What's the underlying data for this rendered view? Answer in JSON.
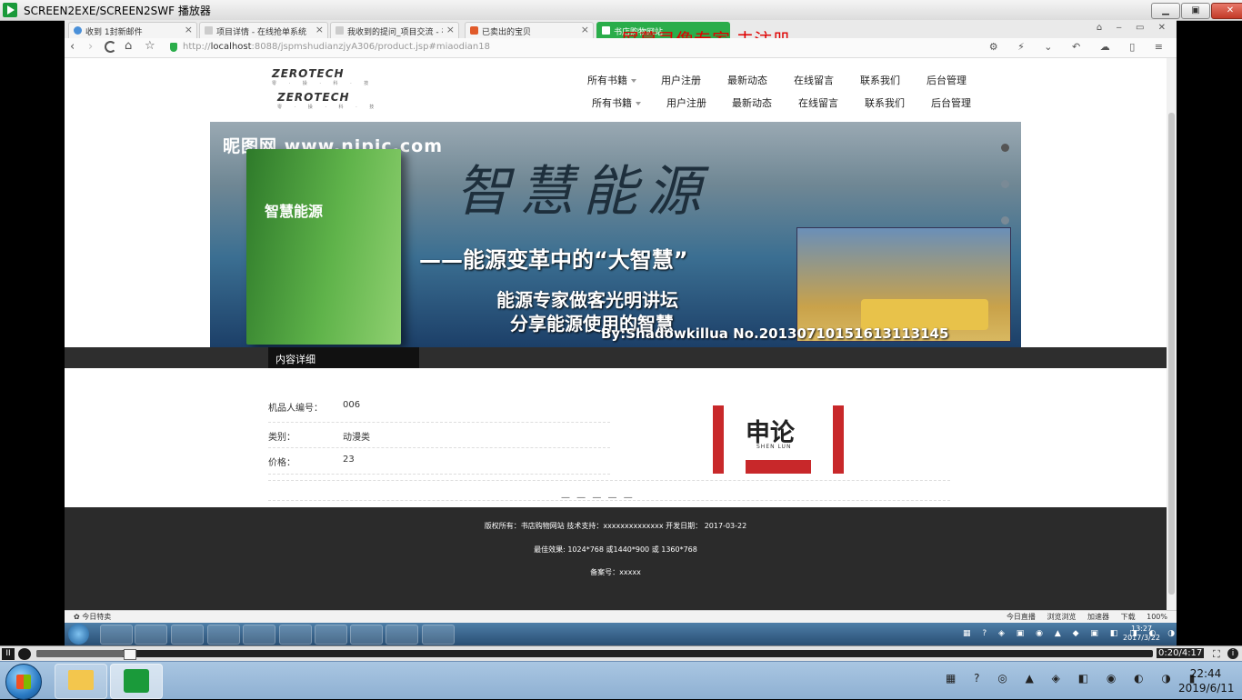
{
  "player": {
    "title": "SCREEN2EXE/SCREEN2SWF 播放器",
    "minimize": "▁",
    "maximize": "▣",
    "close": "✕"
  },
  "browser": {
    "tabs": [
      {
        "label": "收到 1封新邮件"
      },
      {
        "label": "项目详情 - 在线抢单系统"
      },
      {
        "label": "我收到的提问_项目交流 - 在线抢"
      },
      {
        "label": "已卖出的宝贝"
      },
      {
        "label": "书店购物网站"
      }
    ],
    "tab_close": "×",
    "watermark": "屏幕录像专家  未注册",
    "url_prefix": "http://",
    "url_host": "localhost",
    "url_rest": ":8088/jspmshudianzjyA306/product.jsp#miaodian18"
  },
  "site": {
    "logo": "ZEROTECH",
    "logo_sub": "零 · 操 · 科 · 技",
    "menu": [
      "所有书籍",
      "用户注册",
      "最新动态",
      "在线留言",
      "联系我们",
      "后台管理"
    ],
    "banner": {
      "site": "昵图网 www.nipic.com",
      "book_title": "智慧能源",
      "calligraphy": "智慧能源",
      "subtitle": "——能源变革中的“大智慧”",
      "line1": "能源专家做客光明讲坛",
      "line2": "分享能源使用的智慧",
      "credit": "By:Shadowkillua  No.20130710151613113145"
    },
    "section_title": "内容详细",
    "fields": [
      {
        "label": "机品人编号：",
        "value": "006"
      },
      {
        "label": "类别：",
        "value": "动漫类"
      },
      {
        "label": "价格：",
        "value": "23"
      }
    ],
    "product_image_text": "申论",
    "product_image_sub": "SHEN LUN",
    "pager": "— — — — —",
    "footer": {
      "line1": "版权所有：书店购物网站 技术支持：xxxxxxxxxxxxxx 开发日期： 2017-03-22",
      "line2": "最佳效果: 1024*768 或1440*900 或 1360*768",
      "line3": "备案号：xxxxx"
    }
  },
  "statusbar": {
    "left": "今日特卖",
    "right": [
      "今日直播",
      "浏览浏览",
      "加速器",
      "下载",
      "100%"
    ]
  },
  "inner_taskbar": {
    "time": "13:27",
    "date": "2017/3/22"
  },
  "playback": {
    "pause": "II",
    "time": "0:20/4:17",
    "progress": 0.078,
    "fit": "⛶",
    "info": "i"
  },
  "taskbar": {
    "time": "22:44",
    "date": "2019/6/11"
  }
}
